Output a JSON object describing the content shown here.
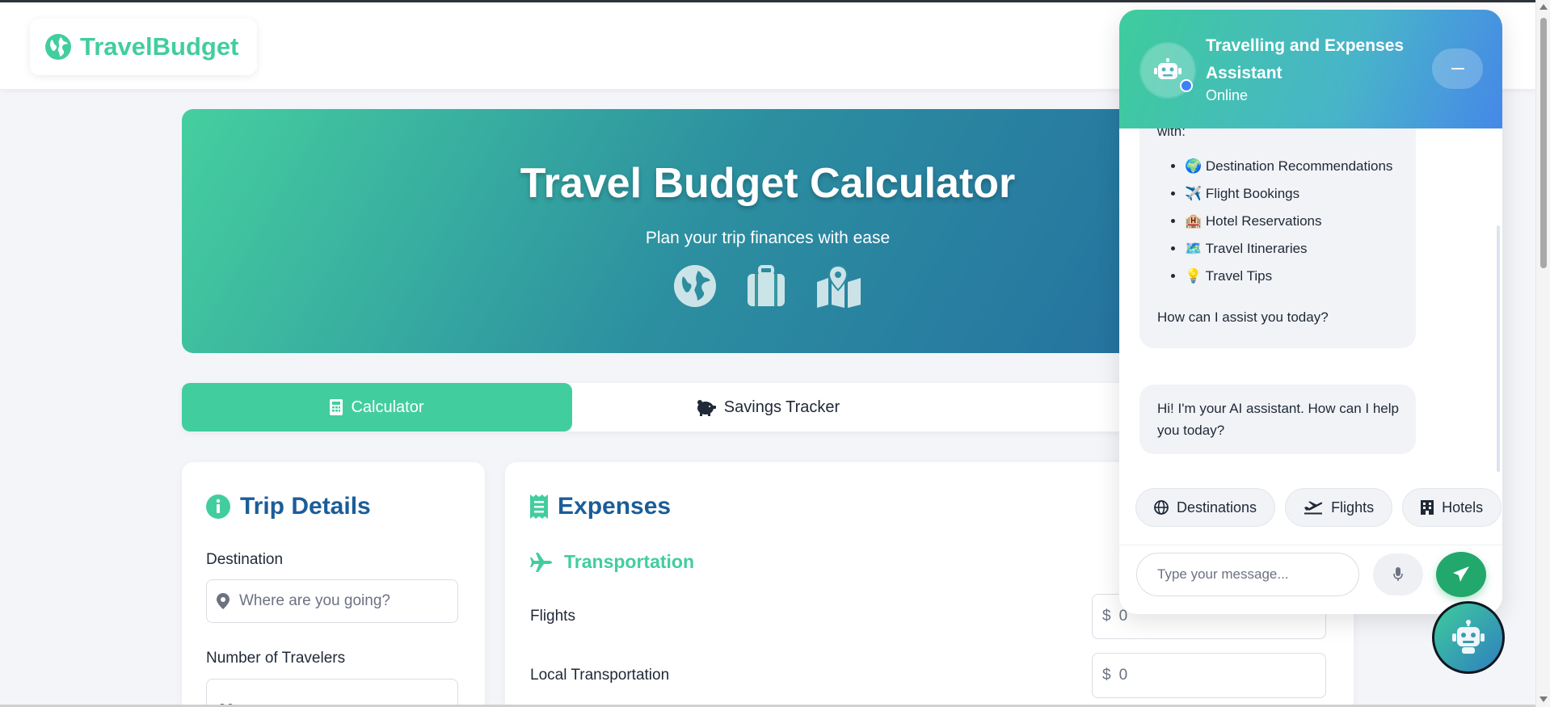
{
  "brand": {
    "name": "TravelBudget"
  },
  "colors": {
    "accent": "#42cd9f",
    "title_blue": "#1b5d99",
    "send_green": "#22a86c"
  },
  "hero": {
    "title": "Travel Budget Calculator",
    "subtitle": "Plan your trip finances with ease",
    "icons": [
      "globe-icon",
      "suitcase-icon",
      "map-icon"
    ]
  },
  "tabs": [
    {
      "label": "Calculator",
      "icon": "calculator-icon",
      "active": true
    },
    {
      "label": "Savings Tracker",
      "icon": "piggy-bank-icon",
      "active": false
    }
  ],
  "trip": {
    "title": "Trip Details",
    "destination_label": "Destination",
    "destination_placeholder": "Where are you going?",
    "travelers_label": "Number of Travelers"
  },
  "expenses": {
    "title": "Expenses",
    "transport_title": "Transportation",
    "rows": [
      {
        "label": "Flights",
        "currency": "$",
        "value": "0"
      },
      {
        "label": "Local Transportation",
        "currency": "$",
        "value": "0"
      }
    ]
  },
  "chat": {
    "title": "Travelling and Expenses Assistant",
    "status": "Online",
    "intro_fragment": "with:",
    "services": [
      "🌍 Destination Recommendations",
      "✈️ Flight Bookings",
      "🏨 Hotel Reservations",
      "🗺️ Travel Itineraries",
      "💡 Travel Tips"
    ],
    "outro": "How can I assist you today?",
    "greeting": "Hi! I'm your AI assistant. How can I help you today?",
    "quick_replies": [
      {
        "label": "Destinations",
        "icon": "globe-icon"
      },
      {
        "label": "Flights",
        "icon": "plane-departure-icon"
      },
      {
        "label": "Hotels",
        "icon": "hotel-icon"
      }
    ],
    "input_placeholder": "Type your message..."
  }
}
